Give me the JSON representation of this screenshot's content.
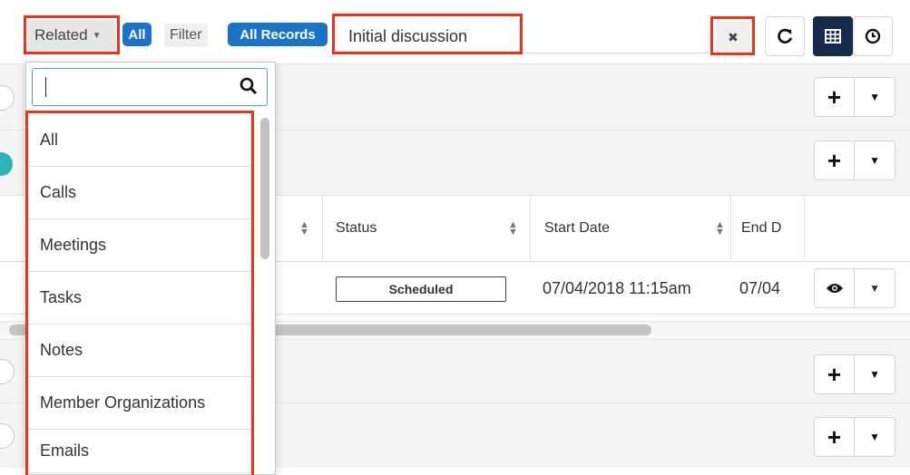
{
  "toolbar": {
    "related_label": "Related",
    "all_pill": "All",
    "filter_label": "Filter",
    "all_records_pill": "All Records",
    "search_value": "Initial discussion",
    "clear_icon": "close-icon",
    "refresh_icon": "refresh-icon",
    "list_view_icon": "table-icon",
    "activity_view_icon": "clock-icon"
  },
  "dropdown": {
    "search_value": "",
    "search_icon": "search-icon",
    "items": [
      "All",
      "Calls",
      "Meetings",
      "Tasks",
      "Notes",
      "Member Organizations",
      "Emails"
    ]
  },
  "table": {
    "headers": [
      "Status",
      "Start Date",
      "End D"
    ],
    "row": {
      "status": "Scheduled",
      "start_date": "07/04/2018 11:15am",
      "end_date": "07/04"
    }
  },
  "colors": {
    "accent": "#1a73c7",
    "highlight": "#e8341c",
    "active_button": "#172b4d",
    "teal": "#2bb3b8"
  }
}
